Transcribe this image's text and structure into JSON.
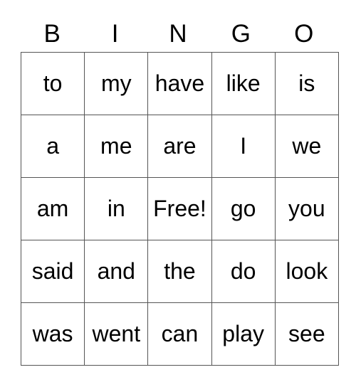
{
  "header": [
    "B",
    "I",
    "N",
    "G",
    "O"
  ],
  "rows": [
    [
      "to",
      "my",
      "have",
      "like",
      "is"
    ],
    [
      "a",
      "me",
      "are",
      "I",
      "we"
    ],
    [
      "am",
      "in",
      "Free!",
      "go",
      "you"
    ],
    [
      "said",
      "and",
      "the",
      "do",
      "look"
    ],
    [
      "was",
      "went",
      "can",
      "play",
      "see"
    ]
  ]
}
